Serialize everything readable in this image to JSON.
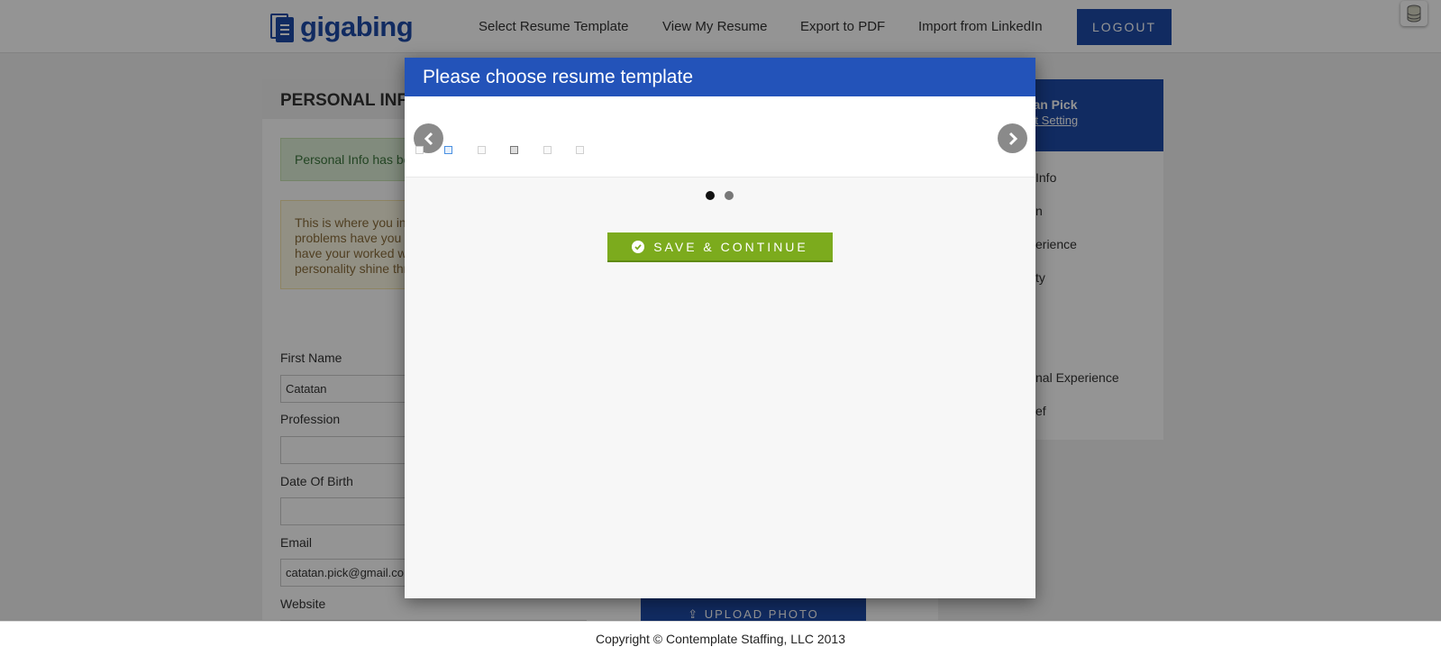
{
  "brand": {
    "logo_text": "gigabing",
    "accent": "#1e4aa8"
  },
  "nav": {
    "items": [
      {
        "label": "Select Resume Template"
      },
      {
        "label": "View My Resume"
      },
      {
        "label": "Export to PDF"
      },
      {
        "label": "Import from LinkedIn"
      }
    ],
    "logout_label": "LOGOUT"
  },
  "form_panel": {
    "title": "PERSONAL INF",
    "success_message": "Personal Info has be",
    "info_lines": [
      "This is where you in",
      "problems have you s",
      "have your worked w",
      "personality shine thr"
    ],
    "fields": [
      {
        "label": "First Name",
        "value": "Catatan"
      },
      {
        "label": "Profession",
        "value": ""
      },
      {
        "label": "Date Of Birth",
        "value": ""
      },
      {
        "label": "Email",
        "value": "catatan.pick@gmail.co"
      },
      {
        "label": "Website",
        "value": ""
      }
    ],
    "upload_label": "UPLOAD PHOTO"
  },
  "side_panel": {
    "user_name": "atan Pick",
    "account_link": "unt Setting",
    "items": [
      {
        "label": "Info"
      },
      {
        "label": "n"
      },
      {
        "label": "erience"
      },
      {
        "label": "ty"
      },
      {
        "label": "nal Experience"
      },
      {
        "label": "ef"
      }
    ]
  },
  "modal": {
    "title": "Please choose resume template",
    "thumbnails": [
      {
        "name": "template-1",
        "state": "normal"
      },
      {
        "name": "template-2",
        "state": "selected"
      },
      {
        "name": "template-3",
        "state": "normal"
      },
      {
        "name": "template-4",
        "state": "dark"
      },
      {
        "name": "template-5",
        "state": "normal"
      },
      {
        "name": "template-6",
        "state": "normal"
      }
    ],
    "pager": {
      "pages": 2,
      "active": 1
    },
    "save_label": "SAVE & CONTINUE",
    "save_color": "#7cab1d"
  },
  "footer": {
    "copyright": "Copyright © Contemplate Staffing, LLC 2013"
  }
}
